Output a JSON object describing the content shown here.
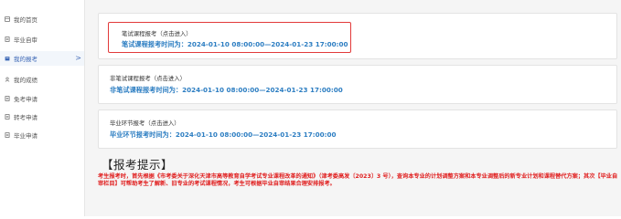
{
  "sidebar": {
    "items": [
      {
        "label": "我的首页",
        "icon": "home-icon"
      },
      {
        "label": "毕业自审",
        "icon": "document-icon"
      },
      {
        "label": "我的报考",
        "icon": "edit-icon",
        "active": true
      },
      {
        "label": "我的成绩",
        "icon": "user-icon"
      },
      {
        "label": "免考申请",
        "icon": "document-icon"
      },
      {
        "label": "转考申请",
        "icon": "document-icon"
      },
      {
        "label": "毕业申请",
        "icon": "document-icon"
      }
    ],
    "active_chevron": ">"
  },
  "cards": [
    {
      "title": "笔试课程报考（点击进入）",
      "time": "笔试课程报考时间为：2024-01-10 08:00:00—2024-01-23 17:00:00"
    },
    {
      "title": "非笔试课程报考（点击进入）",
      "time": "非笔试课程报考时间为：2024-01-10 08:00:00—2024-01-23 17:00:00"
    },
    {
      "title": "毕业环节报考（点击进入）",
      "time": "毕业环节报考时间为：2024-01-10 08:00:00—2024-01-23 17:00:00"
    }
  ],
  "tips": {
    "title": "【报考提示】",
    "text": "考生报考时，首先根据《市考委关于深化天津市高等教育自学考试专业课程改革的通知》（津考委高发〔2023〕3 号），查询本专业的计划调整方案和本专业调整后的新专业计划和课程替代方案；其次【毕业自审栏目】可帮助考生了解新、旧专业的考试课程情况，考生可根据毕业自审结果合理安排报考。"
  },
  "colors": {
    "accent": "#2d7ec2",
    "highlight_border": "#e23a3a",
    "tips_text": "#e01d1d"
  }
}
